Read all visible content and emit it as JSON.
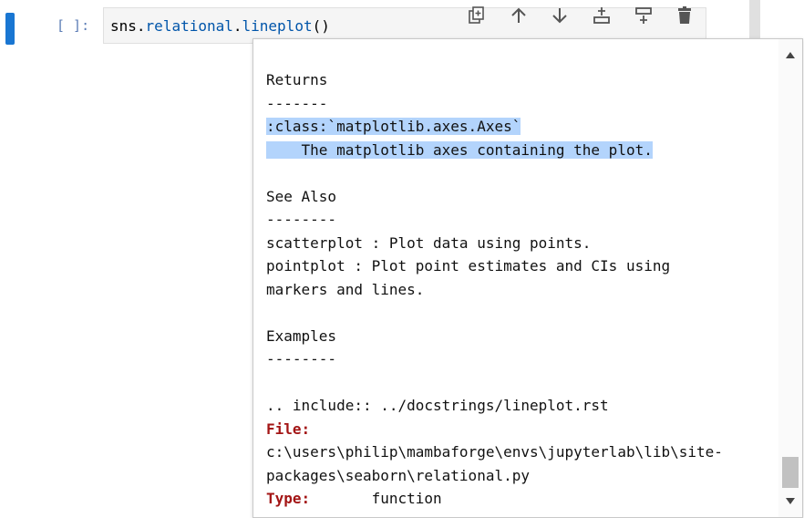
{
  "cell": {
    "prompt": "[ ]:",
    "code_obj": "sns",
    "code_dot1": ".",
    "code_mod": "relational",
    "code_dot2": ".",
    "code_func": "lineplot",
    "code_parens": "()"
  },
  "toolbar": {
    "buttons": [
      "copy-icon",
      "arrow-up-icon",
      "arrow-down-icon",
      "insert-above-icon",
      "insert-below-icon",
      "delete-icon"
    ]
  },
  "tooltip": {
    "lines": [
      "Returns",
      "-------",
      ":class:`matplotlib.axes.Axes`",
      "    The matplotlib axes containing the plot.",
      "",
      "See Also",
      "--------",
      "scatterplot : Plot data using points.",
      "pointplot : Plot point estimates and CIs using",
      "markers and lines.",
      "",
      "Examples",
      "--------",
      "",
      ".. include:: ../docstrings/lineplot.rst"
    ],
    "file_label": "File:",
    "file_path_1": "c:\\users\\philip\\mambaforge\\envs\\jupyterlab\\lib\\site-",
    "file_path_2": "packages\\seaborn\\relational.py",
    "type_label": "Type:",
    "type_value": "function"
  }
}
